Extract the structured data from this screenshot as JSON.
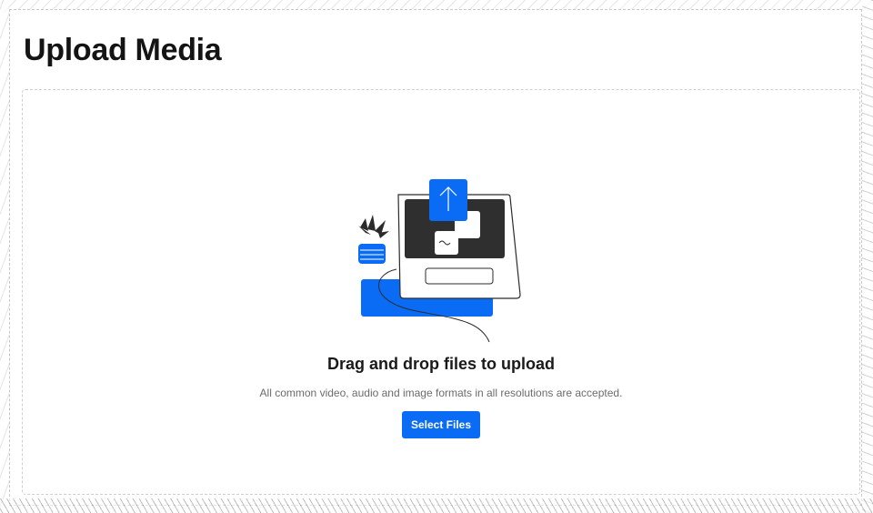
{
  "page": {
    "title": "Upload Media"
  },
  "dropzone": {
    "heading": "Drag and drop files to upload",
    "subtext": "All common video, audio and image formats in all resolutions are accepted.",
    "button_label": "Select Files",
    "illustration_icon": "laptop-upload-illustration"
  },
  "colors": {
    "accent": "#0a6cf5",
    "text_primary": "#141414",
    "text_secondary": "#6b6b6b",
    "screen_dark": "#2f2f2f"
  }
}
